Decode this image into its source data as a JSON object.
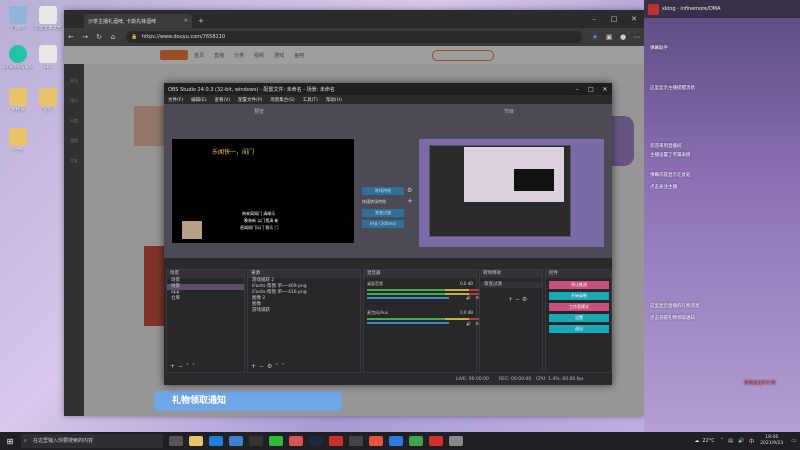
{
  "desktop": {
    "icons": [
      {
        "label": "回收站",
        "color": "#8fb4d6"
      },
      {
        "label": "新建文本文档",
        "color": "#e8e8e8"
      },
      {
        "label": "smartAnywhere",
        "color": "#22c4a8"
      },
      {
        "label": "obs",
        "color": "#e8e8e8"
      },
      {
        "label": "文件夹",
        "color": "#e8c36a"
      },
      {
        "label": "资料",
        "color": "#e8c36a"
      },
      {
        "label": "文件",
        "color": "#e8c36a"
      }
    ]
  },
  "browser": {
    "tab_title": "沙茶主播礼酒啤, 卡斯先锋酒啤",
    "url": "https://www.douyu.com/7658110",
    "site_nav": [
      "首页",
      "直播",
      "分类",
      "视频",
      "游戏",
      "鱼吧"
    ],
    "sidebar_items": [
      "关注",
      "排行",
      "分类",
      "游戏",
      "交友"
    ],
    "banner_text": "礼物领取通知"
  },
  "obs": {
    "title": "OBS Studio 24.0.3 (32-bit, windows) - 配置文件: 未命名 - 场景: 未命名",
    "menu": [
      "文件(F)",
      "编辑(E)",
      "查看(V)",
      "配置文件(P)",
      "场景集合(S)",
      "工具(T)",
      "帮助(H)"
    ],
    "preview_label": "预览",
    "program_label": "节目",
    "preview_caption": "乐闻快一，闺门",
    "preview_note1": "带来闺闺门 清晰乐",
    "preview_note2": "晚装新 以门我清 新",
    "preview_note3": "晋闺闺门乐门 我乐 门",
    "transition_btn": "转场特效",
    "transition_row": "快速转场特效",
    "transition_type": "渐变过渡",
    "duration_label": "时长 (300ms)",
    "docks": {
      "scenes": {
        "title": "场景",
        "items": [
          "场景",
          "场景",
          "app",
          "仓库"
        ]
      },
      "sources": {
        "title": "来源",
        "items": [
          "游戏捕获 2",
          "iFonts-帮我 单一-409.png",
          "iFonts-帮我 单一-416.png",
          "图像 2",
          "图像",
          "游戏捕获"
        ]
      },
      "mixer": {
        "title": "混音器",
        "rows": [
          {
            "name": "桌面音频",
            "db": "0.0 dB"
          },
          {
            "name": "麦克风/Aux",
            "db": "0.0 dB"
          }
        ]
      },
      "transitions": {
        "title": "转场特效",
        "value": "渐变过渡"
      },
      "controls": {
        "title": "控件",
        "buttons": [
          "停止推流",
          "开始录制",
          "工作室模式",
          "设置",
          "退出"
        ]
      }
    },
    "status": {
      "live": "LIVE: 00:00:00",
      "rec": "REC: 00:00:00",
      "cpu": "CPU: 1.4%, 60.00 fps"
    }
  },
  "chat": {
    "user": "xking · infinemore/DMA",
    "lines": [
      "弹幕助手",
      "这里显示主播提醒消息",
      "欢迎来到直播间",
      "主播设置了专属表情",
      "弹幕内容显示在此处",
      "点击关注主播",
      "这里显示直播的礼物消息",
      "点击领取礼物领取通知",
      "感谢送出的礼物"
    ]
  },
  "taskbar": {
    "search_placeholder": "在这里输入你要搜索的内容",
    "temp": "22°C",
    "ime": "中",
    "time": "18:06",
    "date": "2021/9/23"
  },
  "colors": {
    "obs_bg": "#2b2b2e",
    "accent_teal": "#1aa7b8",
    "accent_pink": "#c94f7c",
    "brand_orange": "#f46f1f"
  }
}
